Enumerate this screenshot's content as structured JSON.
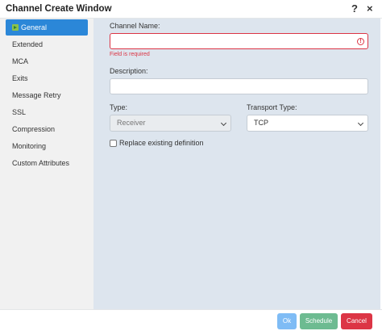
{
  "window": {
    "title": "Channel Create Window",
    "help": "?",
    "close": "×"
  },
  "sidebar": {
    "items": [
      {
        "label": "General"
      },
      {
        "label": "Extended"
      },
      {
        "label": "MCA"
      },
      {
        "label": "Exits"
      },
      {
        "label": "Message Retry"
      },
      {
        "label": "SSL"
      },
      {
        "label": "Compression"
      },
      {
        "label": "Monitoring"
      },
      {
        "label": "Custom Attributes"
      }
    ],
    "active": "General"
  },
  "form": {
    "channel_name_label": "Channel Name:",
    "channel_name_value": "",
    "channel_name_error": "Field is required",
    "description_label": "Description:",
    "description_value": "",
    "type_label": "Type:",
    "type_value": "Receiver",
    "transport_label": "Transport Type:",
    "transport_value": "TCP",
    "replace_label": "Replace existing definition",
    "replace_checked": false
  },
  "footer": {
    "ok": "Ok",
    "schedule": "Schedule",
    "cancel": "Cancel"
  },
  "colors": {
    "active_nav": "#2b87d8",
    "error": "#dc3545",
    "ok": "#7fbcf5",
    "schedule": "#6dbb91",
    "cancel": "#dc3545",
    "panel": "#dde5ee",
    "sidebar": "#f1f1f1"
  },
  "icons": {
    "active_nav": "arrow-right-icon",
    "error": "exclamation-circle-icon",
    "help": "question-icon",
    "close": "close-icon",
    "dropdown": "chevron-down-icon"
  }
}
